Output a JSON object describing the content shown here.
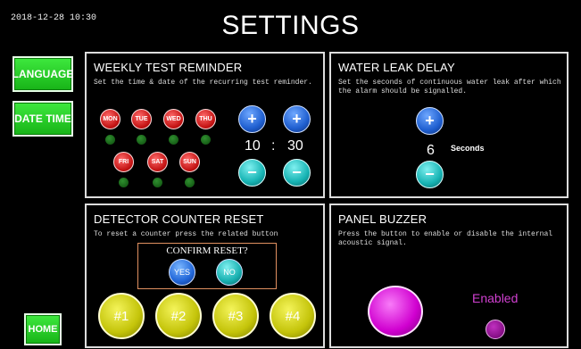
{
  "header": {
    "datetime": "2018-12-28 10:30",
    "title": "SETTINGS"
  },
  "nav": {
    "language": "LANGUAGE",
    "date_time": "DATE TIME",
    "home": "HOME"
  },
  "weekly_test": {
    "title": "WEEKLY TEST REMINDER",
    "description": "Set the time & date of the recurring test reminder.",
    "days": [
      "MON",
      "TUE",
      "WED",
      "THU",
      "FRI",
      "SAT",
      "SUN"
    ],
    "hour": "10",
    "separator": ":",
    "minute": "30",
    "plus_symbol": "+",
    "minus_symbol": "−"
  },
  "water_leak": {
    "title": "WATER LEAK DELAY",
    "description_line1": "Set the seconds of continuous water leak after which",
    "description_line2": "the alarm should be signalled.",
    "value": "6",
    "unit": "Seconds",
    "plus_symbol": "+",
    "minus_symbol": "−"
  },
  "detector_reset": {
    "title": "DETECTOR COUNTER RESET",
    "description": "To reset a counter press the related button",
    "confirm_label": "CONFIRM RESET?",
    "yes": "YES",
    "no": "NO",
    "counters": [
      "#1",
      "#2",
      "#3",
      "#4"
    ]
  },
  "panel_buzzer": {
    "title": "PANEL BUZZER",
    "description_line1": "Press the button to enable or disable the internal",
    "description_line2": "acoustic signal.",
    "status": "Enabled"
  },
  "colors": {
    "nav_green": "#22cc22",
    "day_red": "#d41a1a",
    "plus_blue": "#2a6ee0",
    "minus_cyan": "#1ab8b8",
    "counter_yellow": "#d0d010",
    "buzzer_magenta": "#d000d0"
  }
}
